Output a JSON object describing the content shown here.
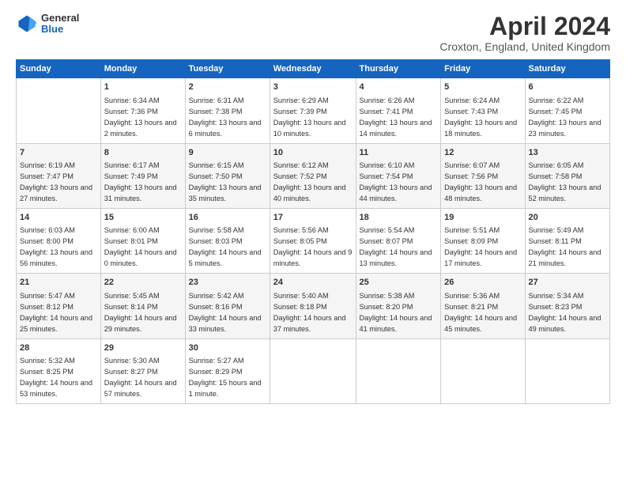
{
  "logo": {
    "line1": "General",
    "line2": "Blue"
  },
  "title": "April 2024",
  "subtitle": "Croxton, England, United Kingdom",
  "headers": [
    "Sunday",
    "Monday",
    "Tuesday",
    "Wednesday",
    "Thursday",
    "Friday",
    "Saturday"
  ],
  "weeks": [
    [
      {
        "day": "",
        "sunrise": "",
        "sunset": "",
        "daylight": ""
      },
      {
        "day": "1",
        "sunrise": "Sunrise: 6:34 AM",
        "sunset": "Sunset: 7:36 PM",
        "daylight": "Daylight: 13 hours and 2 minutes."
      },
      {
        "day": "2",
        "sunrise": "Sunrise: 6:31 AM",
        "sunset": "Sunset: 7:38 PM",
        "daylight": "Daylight: 13 hours and 6 minutes."
      },
      {
        "day": "3",
        "sunrise": "Sunrise: 6:29 AM",
        "sunset": "Sunset: 7:39 PM",
        "daylight": "Daylight: 13 hours and 10 minutes."
      },
      {
        "day": "4",
        "sunrise": "Sunrise: 6:26 AM",
        "sunset": "Sunset: 7:41 PM",
        "daylight": "Daylight: 13 hours and 14 minutes."
      },
      {
        "day": "5",
        "sunrise": "Sunrise: 6:24 AM",
        "sunset": "Sunset: 7:43 PM",
        "daylight": "Daylight: 13 hours and 18 minutes."
      },
      {
        "day": "6",
        "sunrise": "Sunrise: 6:22 AM",
        "sunset": "Sunset: 7:45 PM",
        "daylight": "Daylight: 13 hours and 23 minutes."
      }
    ],
    [
      {
        "day": "7",
        "sunrise": "Sunrise: 6:19 AM",
        "sunset": "Sunset: 7:47 PM",
        "daylight": "Daylight: 13 hours and 27 minutes."
      },
      {
        "day": "8",
        "sunrise": "Sunrise: 6:17 AM",
        "sunset": "Sunset: 7:49 PM",
        "daylight": "Daylight: 13 hours and 31 minutes."
      },
      {
        "day": "9",
        "sunrise": "Sunrise: 6:15 AM",
        "sunset": "Sunset: 7:50 PM",
        "daylight": "Daylight: 13 hours and 35 minutes."
      },
      {
        "day": "10",
        "sunrise": "Sunrise: 6:12 AM",
        "sunset": "Sunset: 7:52 PM",
        "daylight": "Daylight: 13 hours and 40 minutes."
      },
      {
        "day": "11",
        "sunrise": "Sunrise: 6:10 AM",
        "sunset": "Sunset: 7:54 PM",
        "daylight": "Daylight: 13 hours and 44 minutes."
      },
      {
        "day": "12",
        "sunrise": "Sunrise: 6:07 AM",
        "sunset": "Sunset: 7:56 PM",
        "daylight": "Daylight: 13 hours and 48 minutes."
      },
      {
        "day": "13",
        "sunrise": "Sunrise: 6:05 AM",
        "sunset": "Sunset: 7:58 PM",
        "daylight": "Daylight: 13 hours and 52 minutes."
      }
    ],
    [
      {
        "day": "14",
        "sunrise": "Sunrise: 6:03 AM",
        "sunset": "Sunset: 8:00 PM",
        "daylight": "Daylight: 13 hours and 56 minutes."
      },
      {
        "day": "15",
        "sunrise": "Sunrise: 6:00 AM",
        "sunset": "Sunset: 8:01 PM",
        "daylight": "Daylight: 14 hours and 0 minutes."
      },
      {
        "day": "16",
        "sunrise": "Sunrise: 5:58 AM",
        "sunset": "Sunset: 8:03 PM",
        "daylight": "Daylight: 14 hours and 5 minutes."
      },
      {
        "day": "17",
        "sunrise": "Sunrise: 5:56 AM",
        "sunset": "Sunset: 8:05 PM",
        "daylight": "Daylight: 14 hours and 9 minutes."
      },
      {
        "day": "18",
        "sunrise": "Sunrise: 5:54 AM",
        "sunset": "Sunset: 8:07 PM",
        "daylight": "Daylight: 14 hours and 13 minutes."
      },
      {
        "day": "19",
        "sunrise": "Sunrise: 5:51 AM",
        "sunset": "Sunset: 8:09 PM",
        "daylight": "Daylight: 14 hours and 17 minutes."
      },
      {
        "day": "20",
        "sunrise": "Sunrise: 5:49 AM",
        "sunset": "Sunset: 8:11 PM",
        "daylight": "Daylight: 14 hours and 21 minutes."
      }
    ],
    [
      {
        "day": "21",
        "sunrise": "Sunrise: 5:47 AM",
        "sunset": "Sunset: 8:12 PM",
        "daylight": "Daylight: 14 hours and 25 minutes."
      },
      {
        "day": "22",
        "sunrise": "Sunrise: 5:45 AM",
        "sunset": "Sunset: 8:14 PM",
        "daylight": "Daylight: 14 hours and 29 minutes."
      },
      {
        "day": "23",
        "sunrise": "Sunrise: 5:42 AM",
        "sunset": "Sunset: 8:16 PM",
        "daylight": "Daylight: 14 hours and 33 minutes."
      },
      {
        "day": "24",
        "sunrise": "Sunrise: 5:40 AM",
        "sunset": "Sunset: 8:18 PM",
        "daylight": "Daylight: 14 hours and 37 minutes."
      },
      {
        "day": "25",
        "sunrise": "Sunrise: 5:38 AM",
        "sunset": "Sunset: 8:20 PM",
        "daylight": "Daylight: 14 hours and 41 minutes."
      },
      {
        "day": "26",
        "sunrise": "Sunrise: 5:36 AM",
        "sunset": "Sunset: 8:21 PM",
        "daylight": "Daylight: 14 hours and 45 minutes."
      },
      {
        "day": "27",
        "sunrise": "Sunrise: 5:34 AM",
        "sunset": "Sunset: 8:23 PM",
        "daylight": "Daylight: 14 hours and 49 minutes."
      }
    ],
    [
      {
        "day": "28",
        "sunrise": "Sunrise: 5:32 AM",
        "sunset": "Sunset: 8:25 PM",
        "daylight": "Daylight: 14 hours and 53 minutes."
      },
      {
        "day": "29",
        "sunrise": "Sunrise: 5:30 AM",
        "sunset": "Sunset: 8:27 PM",
        "daylight": "Daylight: 14 hours and 57 minutes."
      },
      {
        "day": "30",
        "sunrise": "Sunrise: 5:27 AM",
        "sunset": "Sunset: 8:29 PM",
        "daylight": "Daylight: 15 hours and 1 minute."
      },
      {
        "day": "",
        "sunrise": "",
        "sunset": "",
        "daylight": ""
      },
      {
        "day": "",
        "sunrise": "",
        "sunset": "",
        "daylight": ""
      },
      {
        "day": "",
        "sunrise": "",
        "sunset": "",
        "daylight": ""
      },
      {
        "day": "",
        "sunrise": "",
        "sunset": "",
        "daylight": ""
      }
    ]
  ]
}
